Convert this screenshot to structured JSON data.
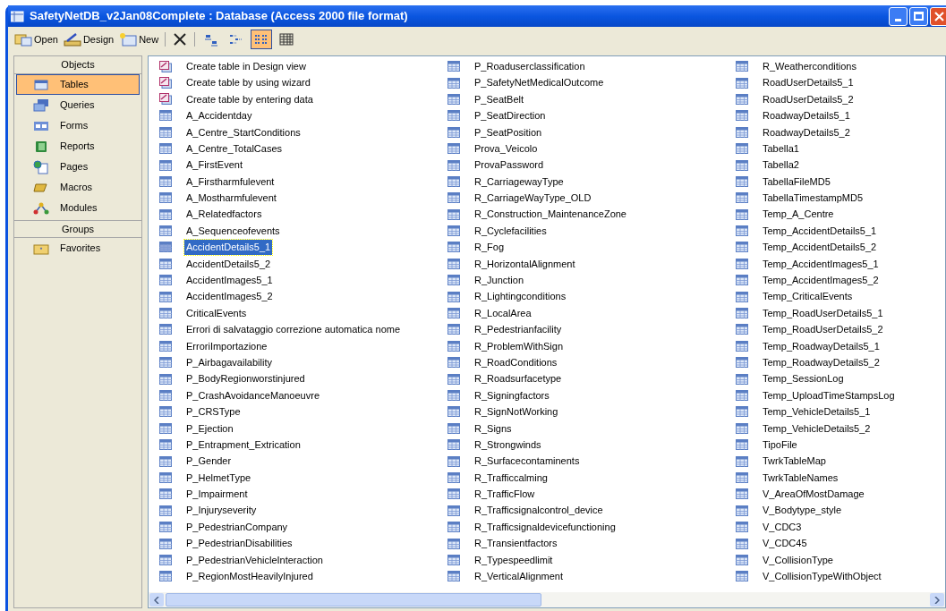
{
  "window": {
    "title": "SafetyNetDB_v2Jan08Complete : Database (Access 2000 file format)"
  },
  "toolbar": {
    "commands": [
      {
        "kind": "open",
        "label": "Open"
      },
      {
        "kind": "design",
        "label": "Design"
      },
      {
        "kind": "new",
        "label": "New"
      },
      {
        "kind": "delete"
      }
    ],
    "views": [
      {
        "kind": "large",
        "selected": false
      },
      {
        "kind": "small",
        "selected": false
      },
      {
        "kind": "list",
        "selected": true
      },
      {
        "kind": "details",
        "selected": false
      }
    ]
  },
  "sidebar": {
    "objects_header": "Objects",
    "objects": [
      {
        "kind": "tables",
        "label": "Tables",
        "selected": true
      },
      {
        "kind": "queries",
        "label": "Queries",
        "selected": false
      },
      {
        "kind": "forms",
        "label": "Forms",
        "selected": false
      },
      {
        "kind": "reports",
        "label": "Reports",
        "selected": false
      },
      {
        "kind": "pages",
        "label": "Pages",
        "selected": false
      },
      {
        "kind": "macros",
        "label": "Macros",
        "selected": false
      },
      {
        "kind": "modules",
        "label": "Modules",
        "selected": false
      }
    ],
    "groups_header": "Groups",
    "groups": [
      {
        "kind": "favorites",
        "label": "Favorites",
        "selected": false
      }
    ]
  },
  "items": [
    {
      "kind": "shortcut",
      "label": "Create table in Design view",
      "selected": false
    },
    {
      "kind": "shortcut",
      "label": "Create table by using wizard",
      "selected": false
    },
    {
      "kind": "shortcut",
      "label": "Create table by entering data",
      "selected": false
    },
    {
      "kind": "table",
      "label": "A_Accidentday",
      "selected": false
    },
    {
      "kind": "table",
      "label": "A_Centre_StartConditions",
      "selected": false
    },
    {
      "kind": "table",
      "label": "A_Centre_TotalCases",
      "selected": false
    },
    {
      "kind": "table",
      "label": "A_FirstEvent",
      "selected": false
    },
    {
      "kind": "table",
      "label": "A_Firstharmfulevent",
      "selected": false
    },
    {
      "kind": "table",
      "label": "A_Mostharmfulevent",
      "selected": false
    },
    {
      "kind": "table",
      "label": "A_Relatedfactors",
      "selected": false
    },
    {
      "kind": "table",
      "label": "A_Sequenceofevents",
      "selected": false
    },
    {
      "kind": "table",
      "label": "AccidentDetails5_1",
      "selected": true
    },
    {
      "kind": "table",
      "label": "AccidentDetails5_2",
      "selected": false
    },
    {
      "kind": "table",
      "label": "AccidentImages5_1",
      "selected": false
    },
    {
      "kind": "table",
      "label": "AccidentImages5_2",
      "selected": false
    },
    {
      "kind": "table",
      "label": "CriticalEvents",
      "selected": false
    },
    {
      "kind": "table",
      "label": "Errori di salvataggio correzione automatica nome",
      "selected": false
    },
    {
      "kind": "table",
      "label": "ErroriImportazione",
      "selected": false
    },
    {
      "kind": "table",
      "label": "P_Airbagavailability",
      "selected": false
    },
    {
      "kind": "table",
      "label": "P_BodyRegionworstinjured",
      "selected": false
    },
    {
      "kind": "table",
      "label": "P_CrashAvoidanceManoeuvre",
      "selected": false
    },
    {
      "kind": "table",
      "label": "P_CRSType",
      "selected": false
    },
    {
      "kind": "table",
      "label": "P_Ejection",
      "selected": false
    },
    {
      "kind": "table",
      "label": "P_Entrapment_Extrication",
      "selected": false
    },
    {
      "kind": "table",
      "label": "P_Gender",
      "selected": false
    },
    {
      "kind": "table",
      "label": "P_HelmetType",
      "selected": false
    },
    {
      "kind": "table",
      "label": "P_Impairment",
      "selected": false
    },
    {
      "kind": "table",
      "label": "P_Injuryseverity",
      "selected": false
    },
    {
      "kind": "table",
      "label": "P_PedestrianCompany",
      "selected": false
    },
    {
      "kind": "table",
      "label": "P_PedestrianDisabilities",
      "selected": false
    },
    {
      "kind": "table",
      "label": "P_PedestrianVehicleInteraction",
      "selected": false
    },
    {
      "kind": "table",
      "label": "P_RegionMostHeavilyInjured",
      "selected": false
    },
    {
      "kind": "table",
      "label": "P_Roaduserclassification",
      "selected": false
    },
    {
      "kind": "table",
      "label": "P_SafetyNetMedicalOutcome",
      "selected": false
    },
    {
      "kind": "table",
      "label": "P_SeatBelt",
      "selected": false
    },
    {
      "kind": "table",
      "label": "P_SeatDirection",
      "selected": false
    },
    {
      "kind": "table",
      "label": "P_SeatPosition",
      "selected": false
    },
    {
      "kind": "table",
      "label": "Prova_Veicolo",
      "selected": false
    },
    {
      "kind": "table",
      "label": "ProvaPassword",
      "selected": false
    },
    {
      "kind": "table",
      "label": "R_CarriagewayType",
      "selected": false
    },
    {
      "kind": "table",
      "label": "R_CarriageWayType_OLD",
      "selected": false
    },
    {
      "kind": "table",
      "label": "R_Construction_MaintenanceZone",
      "selected": false
    },
    {
      "kind": "table",
      "label": "R_Cyclefacilities",
      "selected": false
    },
    {
      "kind": "table",
      "label": "R_Fog",
      "selected": false
    },
    {
      "kind": "table",
      "label": "R_HorizontalAlignment",
      "selected": false
    },
    {
      "kind": "table",
      "label": "R_Junction",
      "selected": false
    },
    {
      "kind": "table",
      "label": "R_Lightingconditions",
      "selected": false
    },
    {
      "kind": "table",
      "label": "R_LocalArea",
      "selected": false
    },
    {
      "kind": "table",
      "label": "R_Pedestrianfacility",
      "selected": false
    },
    {
      "kind": "table",
      "label": "R_ProblemWithSign",
      "selected": false
    },
    {
      "kind": "table",
      "label": "R_RoadConditions",
      "selected": false
    },
    {
      "kind": "table",
      "label": "R_Roadsurfacetype",
      "selected": false
    },
    {
      "kind": "table",
      "label": "R_Signingfactors",
      "selected": false
    },
    {
      "kind": "table",
      "label": "R_SignNotWorking",
      "selected": false
    },
    {
      "kind": "table",
      "label": "R_Signs",
      "selected": false
    },
    {
      "kind": "table",
      "label": "R_Strongwinds",
      "selected": false
    },
    {
      "kind": "table",
      "label": "R_Surfacecontaminents",
      "selected": false
    },
    {
      "kind": "table",
      "label": "R_Trafficcalming",
      "selected": false
    },
    {
      "kind": "table",
      "label": "R_TrafficFlow",
      "selected": false
    },
    {
      "kind": "table",
      "label": "R_Trafficsignalcontrol_device",
      "selected": false
    },
    {
      "kind": "table",
      "label": "R_Trafficsignaldevicefunctioning",
      "selected": false
    },
    {
      "kind": "table",
      "label": "R_Transientfactors",
      "selected": false
    },
    {
      "kind": "table",
      "label": "R_Typespeedlimit",
      "selected": false
    },
    {
      "kind": "table",
      "label": "R_VerticalAlignment",
      "selected": false
    },
    {
      "kind": "table",
      "label": "R_Weatherconditions",
      "selected": false
    },
    {
      "kind": "table",
      "label": "RoadUserDetails5_1",
      "selected": false
    },
    {
      "kind": "table",
      "label": "RoadUserDetails5_2",
      "selected": false
    },
    {
      "kind": "table",
      "label": "RoadwayDetails5_1",
      "selected": false
    },
    {
      "kind": "table",
      "label": "RoadwayDetails5_2",
      "selected": false
    },
    {
      "kind": "table",
      "label": "Tabella1",
      "selected": false
    },
    {
      "kind": "table",
      "label": "Tabella2",
      "selected": false
    },
    {
      "kind": "table",
      "label": "TabellaFileMD5",
      "selected": false
    },
    {
      "kind": "table",
      "label": "TabellaTimestampMD5",
      "selected": false
    },
    {
      "kind": "table",
      "label": "Temp_A_Centre",
      "selected": false
    },
    {
      "kind": "table",
      "label": "Temp_AccidentDetails5_1",
      "selected": false
    },
    {
      "kind": "table",
      "label": "Temp_AccidentDetails5_2",
      "selected": false
    },
    {
      "kind": "table",
      "label": "Temp_AccidentImages5_1",
      "selected": false
    },
    {
      "kind": "table",
      "label": "Temp_AccidentImages5_2",
      "selected": false
    },
    {
      "kind": "table",
      "label": "Temp_CriticalEvents",
      "selected": false
    },
    {
      "kind": "table",
      "label": "Temp_RoadUserDetails5_1",
      "selected": false
    },
    {
      "kind": "table",
      "label": "Temp_RoadUserDetails5_2",
      "selected": false
    },
    {
      "kind": "table",
      "label": "Temp_RoadwayDetails5_1",
      "selected": false
    },
    {
      "kind": "table",
      "label": "Temp_RoadwayDetails5_2",
      "selected": false
    },
    {
      "kind": "table",
      "label": "Temp_SessionLog",
      "selected": false
    },
    {
      "kind": "table",
      "label": "Temp_UploadTimeStampsLog",
      "selected": false
    },
    {
      "kind": "table",
      "label": "Temp_VehicleDetails5_1",
      "selected": false
    },
    {
      "kind": "table",
      "label": "Temp_VehicleDetails5_2",
      "selected": false
    },
    {
      "kind": "table",
      "label": "TipoFile",
      "selected": false
    },
    {
      "kind": "table",
      "label": "TwrkTableMap",
      "selected": false
    },
    {
      "kind": "table",
      "label": "TwrkTableNames",
      "selected": false
    },
    {
      "kind": "table",
      "label": "V_AreaOfMostDamage",
      "selected": false
    },
    {
      "kind": "table",
      "label": "V_Bodytype_style",
      "selected": false
    },
    {
      "kind": "table",
      "label": "V_CDC3",
      "selected": false
    },
    {
      "kind": "table",
      "label": "V_CDC45",
      "selected": false
    },
    {
      "kind": "table",
      "label": "V_CollisionType",
      "selected": false
    },
    {
      "kind": "table",
      "label": "V_CollisionTypeWithObject",
      "selected": false
    }
  ]
}
